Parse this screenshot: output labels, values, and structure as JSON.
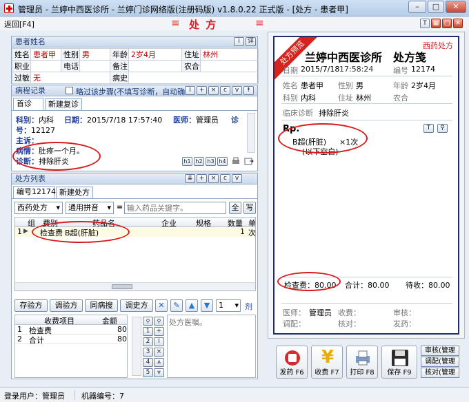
{
  "window": {
    "title": "管理员 - 兰婷中西医诊所 - 兰婷门诊网络版(注册码版) v1.8.0.22 正式版 - [处方 - 患者甲]",
    "min": "–",
    "max": "□",
    "close": "✕"
  },
  "toolbar": {
    "back": "返回[F4]",
    "title": "处 方",
    "mark": "≡",
    "icons": [
      "T",
      "▦",
      "▢",
      "✕"
    ]
  },
  "patient": {
    "header": "患者姓名",
    "btn_i": "I",
    "btn_more": "详",
    "labels": {
      "name": "姓名",
      "gender": "性别",
      "age": "年龄",
      "address": "住址",
      "job": "职业",
      "phone": "电话",
      "note": "备注",
      "nongcard": "农合号",
      "allergy": "过敏",
      "history": "病史"
    },
    "name": "患者甲",
    "gender": "男",
    "age": "2岁4月",
    "address": "林州",
    "allergy": "无"
  },
  "record": {
    "header": "病程记录",
    "skip_label": "略过该步骤(不填写诊断，自动确诊",
    "tool_buttons": [
      "I",
      "+",
      "×",
      "c",
      "v",
      "⯭"
    ],
    "tabs": [
      "首诊",
      "新建复诊"
    ],
    "dept_label": "科别：",
    "dept": "内科",
    "date_label": "日期：",
    "date": "2015/7/18 17:57:40",
    "doctor_label": "医师：",
    "doctor": "管理员",
    "no_label_a": "诊",
    "no_label_b": "号：",
    "no": "12127",
    "complaint_label": "主诉：",
    "illness_label": "病情：",
    "illness": "肚疼一个月。",
    "diag_label": "诊断：",
    "diag": "排除肝炎",
    "hbtns": [
      "h1",
      "h2",
      "h3",
      "h4"
    ]
  },
  "rxlist": {
    "header": "处方列表",
    "tool_buttons": [
      "⇊",
      "+",
      "×",
      "c",
      "v"
    ],
    "tabs": [
      "编号12174",
      "新建处方"
    ],
    "type": "西药处方",
    "input_method": "通用拼音",
    "eq": "=",
    "placeholder": "输入药品关键字。",
    "all": "全",
    "write": "写",
    "columns": [
      "组",
      "费别",
      "药品名",
      "企业",
      "规格",
      "数量",
      "单"
    ],
    "rows": [
      {
        "idx": "1",
        "cat": "检查费",
        "name": "B超(肝脏)",
        "qty": "1",
        "unit": "次"
      }
    ],
    "actions": [
      "存验方",
      "调验方",
      "同病搜",
      "调史方"
    ],
    "count": "1",
    "count_suffix": "剂",
    "fee_columns": [
      "收费项目",
      "金额"
    ],
    "fees": [
      {
        "idx": "1",
        "item": "检查费",
        "amount": "80"
      },
      {
        "idx": "2",
        "item": "合计",
        "amount": "80"
      }
    ],
    "num_buttons": [
      "1",
      "2",
      "3",
      "4",
      "5"
    ],
    "op_buttons": [
      "+",
      "I",
      "×",
      "⊗",
      "⩓",
      "⩔"
    ],
    "advice_placeholder": "处方医嘱。"
  },
  "rx_paper": {
    "ribbon": "处方预览",
    "type_tag": "西药处方",
    "clinic": "兰婷中西医诊所",
    "heading": "处方笺",
    "date_label": "日期",
    "date_value": "2015/7/18",
    "time_overlap": "17:58:24",
    "no_label": "编号",
    "no_value": "12174",
    "name_label": "姓名",
    "name": "患者甲",
    "gender_label": "性别",
    "gender": "男",
    "age_label": "年龄",
    "age": "2岁4月",
    "dept_label": "科别",
    "dept": "内科",
    "addr_label": "住址",
    "addr": "林州",
    "nh_label": "农合",
    "diag_label": "临床诊断",
    "diag": "排除肝炎",
    "rp": "Rp.",
    "item": "B超(肝脏)",
    "qty": "×1次",
    "blank": "(以下空白)",
    "total_item_label": "检查费：80.00",
    "sum_label": "合计：80.00",
    "pending_label": "待收：80.00",
    "doctor_label": "医师：",
    "doctor": "管理员",
    "charge_label": "收费：",
    "audit_label": "审核：",
    "dispense_label": "调配：",
    "check_label": "核对：",
    "send_label": "发药："
  },
  "actions": [
    {
      "label": "发药 F6"
    },
    {
      "label": "收费 F7"
    },
    {
      "label": "打印 F8"
    },
    {
      "label": "保存 F9"
    }
  ],
  "side_actions": [
    "审核(管理",
    "调配(管理",
    "核对(管理"
  ],
  "status": {
    "user_label": "登录用户：管理员",
    "machine_label": "机器编号：7"
  }
}
